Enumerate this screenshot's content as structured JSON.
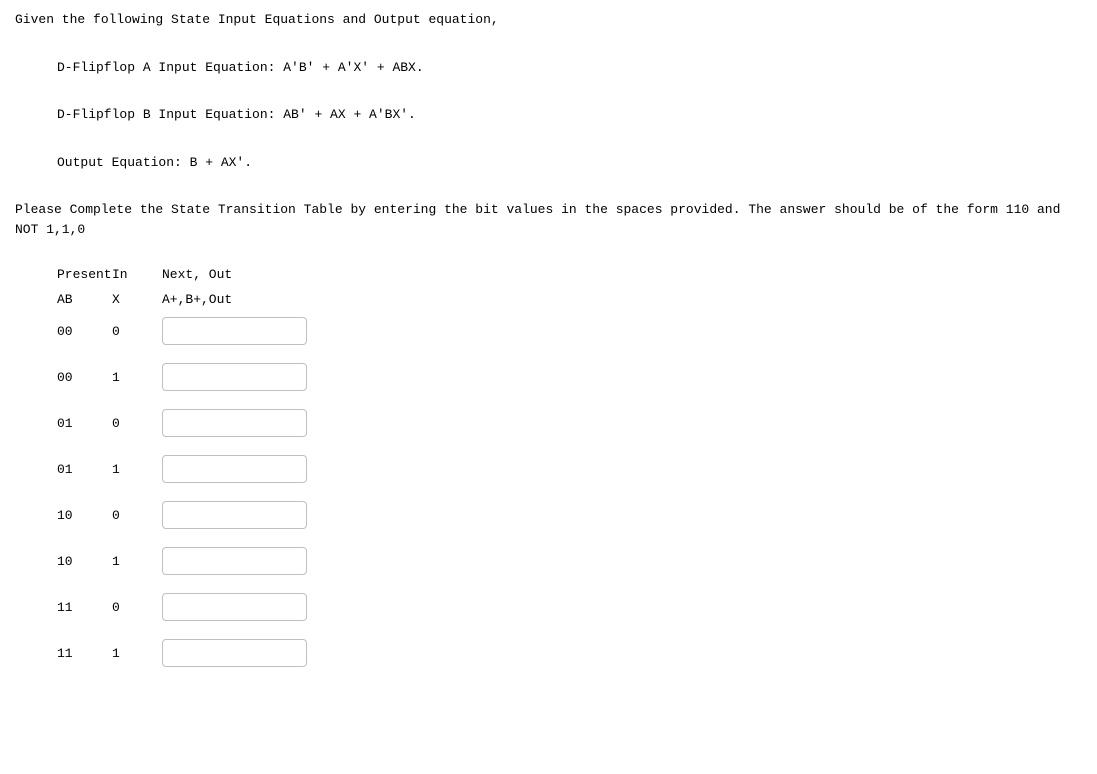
{
  "intro": "Given the following State Input Equations and Output equation,",
  "eqA": "D-Flipflop A Input Equation: A'B' + A'X' + ABX.",
  "eqB": "D-Flipflop B Input Equation: AB' + AX + A'BX'.",
  "eqOut": "Output Equation: B + AX'.",
  "instructions": "Please Complete the State Transition Table by entering the bit values in the spaces provided. The answer should be of the form 110 and NOT 1,1,0",
  "header": {
    "present": "Present",
    "in": "In",
    "nextout": "Next, Out",
    "ab": "AB",
    "x": "X",
    "cols": "A+,B+,Out"
  },
  "rows": [
    {
      "ab": "00",
      "x": "0",
      "val": ""
    },
    {
      "ab": "00",
      "x": "1",
      "val": ""
    },
    {
      "ab": "01",
      "x": "0",
      "val": ""
    },
    {
      "ab": "01",
      "x": "1",
      "val": ""
    },
    {
      "ab": "10",
      "x": "0",
      "val": ""
    },
    {
      "ab": "10",
      "x": "1",
      "val": ""
    },
    {
      "ab": "11",
      "x": "0",
      "val": ""
    },
    {
      "ab": "11",
      "x": "1",
      "val": ""
    }
  ]
}
